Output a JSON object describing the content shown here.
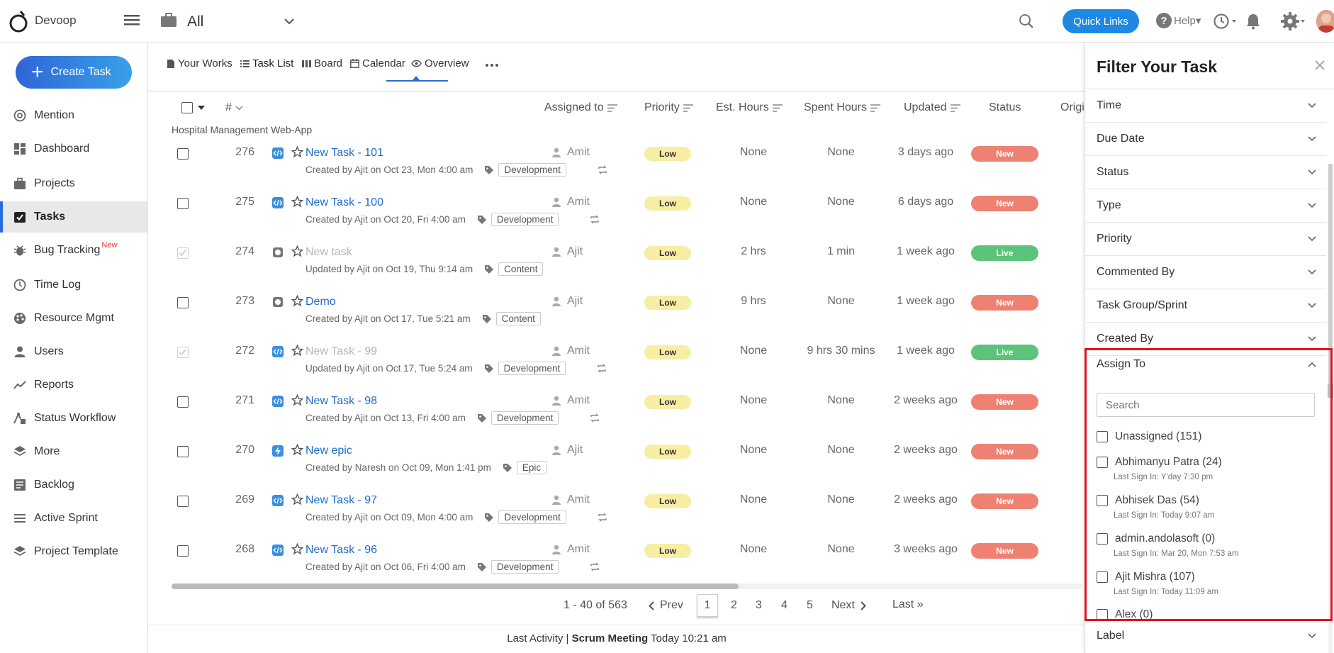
{
  "app": {
    "brand": "Devoop",
    "project": "All",
    "quick_links": "Quick Links",
    "help": "Help▾"
  },
  "sidebar": {
    "create_task": "Create Task",
    "items": [
      {
        "label": "Mention",
        "icon": "at-icon"
      },
      {
        "label": "Dashboard",
        "icon": "dashboard-icon"
      },
      {
        "label": "Projects",
        "icon": "briefcase-icon"
      },
      {
        "label": "Tasks",
        "icon": "task-check-icon",
        "active": true
      },
      {
        "label": "Bug Tracking",
        "icon": "bug-icon",
        "badge": "New"
      },
      {
        "label": "Time Log",
        "icon": "clock-icon"
      },
      {
        "label": "Resource Mgmt",
        "icon": "palette-icon"
      },
      {
        "label": "Users",
        "icon": "user-icon"
      },
      {
        "label": "Reports",
        "icon": "chart-line-icon"
      },
      {
        "label": "Status Workflow",
        "icon": "workflow-icon"
      },
      {
        "label": "More",
        "icon": "layers-icon"
      },
      {
        "label": "Backlog",
        "icon": "backlog-icon"
      },
      {
        "label": "Active Sprint",
        "icon": "list-icon"
      },
      {
        "label": "Project Template",
        "icon": "layers-icon"
      }
    ]
  },
  "tabs": [
    {
      "label": "Your Works",
      "icon": "doc-icon"
    },
    {
      "label": "Task List",
      "icon": "list-icon",
      "active": true
    },
    {
      "label": "Board",
      "icon": "board-icon"
    },
    {
      "label": "Calendar",
      "icon": "calendar-icon"
    },
    {
      "label": "Overview",
      "icon": "eye-icon"
    }
  ],
  "table": {
    "headers": {
      "num": "#",
      "assigned": "Assigned to",
      "priority": "Priority",
      "est": "Est. Hours",
      "spent": "Spent Hours",
      "updated": "Updated",
      "status": "Status",
      "origin": "Origi"
    },
    "group": "Hospital Management Web-App",
    "rows": [
      {
        "num": "276",
        "title": "New Task - 101",
        "meta": "Created by Ajit on Oct 23, Mon 4:00 am",
        "tag": "Development",
        "assignee": "Amit",
        "priority": "Low",
        "est": "None",
        "spent": "None",
        "updated": "3 days ago",
        "status": "New",
        "type": "code",
        "done": false,
        "repeat": true
      },
      {
        "num": "275",
        "title": "New Task - 100",
        "meta": "Created by Ajit on Oct 20, Fri 4:00 am",
        "tag": "Development",
        "assignee": "Amit",
        "priority": "Low",
        "est": "None",
        "spent": "None",
        "updated": "6 days ago",
        "status": "New",
        "type": "code",
        "done": false,
        "repeat": true
      },
      {
        "num": "274",
        "title": "New task",
        "meta": "Updated by Ajit on Oct 19, Thu 9:14 am",
        "tag": "Content",
        "assignee": "Ajit",
        "priority": "Low",
        "est": "2 hrs",
        "spent": "1 min",
        "updated": "1 week ago",
        "status": "Live",
        "type": "content",
        "done": true,
        "repeat": false
      },
      {
        "num": "273",
        "title": "Demo",
        "meta": "Created by Ajit on Oct 17, Tue 5:21 am",
        "tag": "Content",
        "assignee": "Ajit",
        "priority": "Low",
        "est": "9 hrs",
        "spent": "None",
        "updated": "1 week ago",
        "status": "New",
        "type": "content",
        "done": false,
        "repeat": false
      },
      {
        "num": "272",
        "title": "New Task - 99",
        "meta": "Updated by Ajit on Oct 17, Tue 5:24 am",
        "tag": "Development",
        "assignee": "Amit",
        "priority": "Low",
        "est": "None",
        "spent": "9 hrs 30 mins",
        "updated": "1 week ago",
        "status": "Live",
        "type": "code",
        "done": true,
        "repeat": true
      },
      {
        "num": "271",
        "title": "New Task - 98",
        "meta": "Created by Ajit on Oct 13, Fri 4:00 am",
        "tag": "Development",
        "assignee": "Amit",
        "priority": "Low",
        "est": "None",
        "spent": "None",
        "updated": "2 weeks ago",
        "status": "New",
        "type": "code",
        "done": false,
        "repeat": true
      },
      {
        "num": "270",
        "title": "New epic",
        "meta": "Created by Naresh on Oct 09, Mon 1:41 pm",
        "tag": "Epic",
        "assignee": "Ajit",
        "priority": "Low",
        "est": "None",
        "spent": "None",
        "updated": "2 weeks ago",
        "status": "New",
        "type": "epic",
        "done": false,
        "repeat": false
      },
      {
        "num": "269",
        "title": "New Task - 97",
        "meta": "Created by Ajit on Oct 09, Mon 4:00 am",
        "tag": "Development",
        "assignee": "Amit",
        "priority": "Low",
        "est": "None",
        "spent": "None",
        "updated": "2 weeks ago",
        "status": "New",
        "type": "code",
        "done": false,
        "repeat": true
      },
      {
        "num": "268",
        "title": "New Task - 96",
        "meta": "Created by Ajit on Oct 06, Fri 4:00 am",
        "tag": "Development",
        "assignee": "Amit",
        "priority": "Low",
        "est": "None",
        "spent": "None",
        "updated": "3 weeks ago",
        "status": "New",
        "type": "code",
        "done": false,
        "repeat": true
      }
    ]
  },
  "pager": {
    "range": "1 - 40 of 563",
    "prev": "Prev",
    "pages": [
      "1",
      "2",
      "3",
      "4",
      "5"
    ],
    "next": "Next",
    "last": "Last »"
  },
  "footer": {
    "prefix": "Last Activity | ",
    "activity": "Scrum Meeting",
    "time": " Today 10:21 am"
  },
  "filter": {
    "title": "Filter Your Task",
    "sections": [
      "Time",
      "Due Date",
      "Status",
      "Type",
      "Priority",
      "Commented By",
      "Task Group/Sprint",
      "Created By"
    ],
    "assign_to": "Assign To",
    "search_placeholder": "Search",
    "users": [
      {
        "name": "Unassigned (151)",
        "sign": ""
      },
      {
        "name": "Abhimanyu Patra (24)",
        "sign": "Last Sign In: Y'day 7:30 pm"
      },
      {
        "name": "Abhisek Das (54)",
        "sign": "Last Sign In: Today 9:07 am"
      },
      {
        "name": "admin.andolasoft (0)",
        "sign": "Last Sign In: Mar 20, Mon 7:53 am"
      },
      {
        "name": "Ajit Mishra (107)",
        "sign": "Last Sign In: Today 11:09 am"
      },
      {
        "name": "Alex (0)",
        "sign": ""
      }
    ],
    "label": "Label"
  },
  "colors": {
    "accent": "#1e88e5",
    "new": "#ef8173",
    "live": "#5cc47a",
    "low": "#f7eea3",
    "highlight": "#e0141e"
  }
}
